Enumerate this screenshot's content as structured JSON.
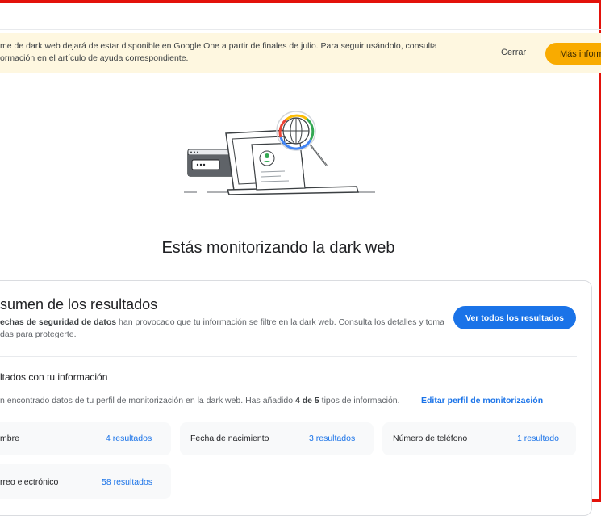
{
  "banner": {
    "line1": "me de dark web dejará de estar disponible en Google One a partir de finales de julio. Para seguir usándolo, consulta",
    "line2": "ormación en el artículo de ayuda correspondiente.",
    "close_label": "Cerrar",
    "more_label": "Más inform"
  },
  "hero": {
    "title": "Estás monitorizando la dark web"
  },
  "summary": {
    "title": "sumen de los resultados",
    "desc_bold": "echas de seguridad de datos",
    "desc_rest": " han provocado que tu información se filtre en la dark web. Consulta los detalles y toma",
    "desc_line2": "das para protegerte.",
    "view_all_label": "Ver todos los resultados"
  },
  "results": {
    "title": "ltados con tu información",
    "desc_pre": "n encontrado datos de tu perfil de monitorización en la dark web. Has añadido ",
    "desc_bold": "4 de 5",
    "desc_post": " tipos de información.",
    "edit_label": "Editar perfil de monitorización",
    "items": [
      {
        "label": "mbre",
        "count": "4 resultados"
      },
      {
        "label": "Fecha de nacimiento",
        "count": "3 resultados"
      },
      {
        "label": "Número de teléfono",
        "count": "1 resultado"
      },
      {
        "label": "rreo electrónico",
        "count": "58 resultados"
      }
    ]
  },
  "colors": {
    "banner_bg": "#fef7e0",
    "banner_button": "#f9ab00",
    "primary": "#1a73e8",
    "frame": "#e3120b"
  }
}
